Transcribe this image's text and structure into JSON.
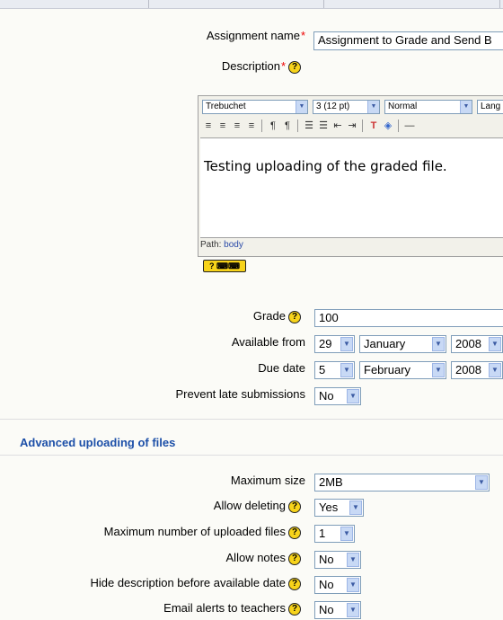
{
  "form": {
    "assignment_name_label": "Assignment name",
    "required_mark": "*",
    "assignment_name_value": "Assignment to Grade and Send B",
    "description_label": "Description",
    "help_mark": "?"
  },
  "editor": {
    "font_select": "Trebuchet",
    "size_select": "3 (12 pt)",
    "format_select": "Normal",
    "lang_select": "Lang",
    "toolbar_icons": [
      "align-left-icon",
      "align-center-icon",
      "align-right-icon",
      "justify-icon",
      "ltr-icon",
      "rtl-icon",
      "ordered-list-icon",
      "unordered-list-icon",
      "outdent-icon",
      "indent-icon",
      "text-color-icon",
      "background-color-icon",
      "horizontal-rule-icon"
    ],
    "content": "Testing uploading of the graded file.",
    "path_label": "Path:",
    "path_value": "body",
    "keyboard_help": "?"
  },
  "grading": {
    "grade_label": "Grade",
    "grade_value": "100",
    "available_from_label": "Available from",
    "available_day": "29",
    "available_month": "January",
    "available_year": "2008",
    "due_date_label": "Due date",
    "due_day": "5",
    "due_month": "February",
    "due_year": "2008",
    "prevent_late_label": "Prevent late submissions",
    "prevent_late_value": "No"
  },
  "advanced": {
    "section_title": "Advanced uploading of files",
    "max_size_label": "Maximum size",
    "max_size_value": "2MB",
    "allow_deleting_label": "Allow deleting",
    "allow_deleting_value": "Yes",
    "max_files_label": "Maximum number of uploaded files",
    "max_files_value": "1",
    "allow_notes_label": "Allow notes",
    "allow_notes_value": "No",
    "hide_desc_label": "Hide description before available date",
    "hide_desc_value": "No",
    "email_alerts_label": "Email alerts to teachers",
    "email_alerts_value": "No"
  },
  "colors": {
    "section_title": "#1c4fa8",
    "required": "#e00000",
    "help_icon": "#f7d31a"
  }
}
